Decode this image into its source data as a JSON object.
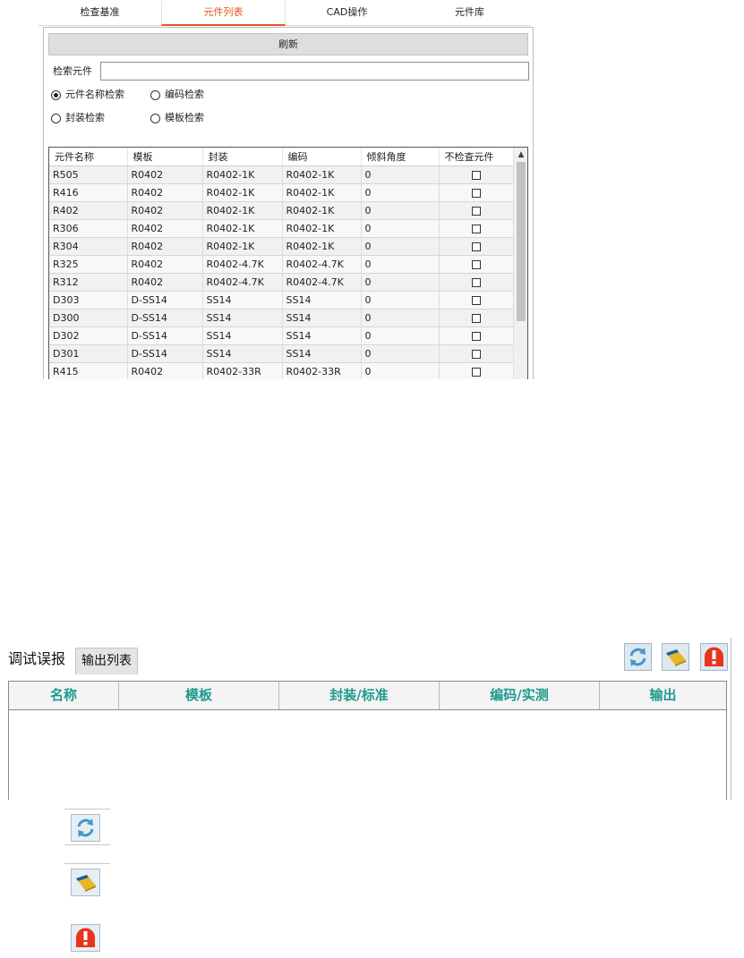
{
  "top_tabs": [
    {
      "label": "检查基准",
      "active": false
    },
    {
      "label": "元件列表",
      "active": true
    },
    {
      "label": "CAD操作",
      "active": false
    },
    {
      "label": "元件库",
      "active": false
    }
  ],
  "refresh_label": "刷新",
  "search": {
    "label": "检索元件",
    "value": ""
  },
  "radios": [
    {
      "label": "元件名称检索",
      "checked": true
    },
    {
      "label": "编码检索",
      "checked": false
    },
    {
      "label": "封装检索",
      "checked": false
    },
    {
      "label": "模板检索",
      "checked": false
    }
  ],
  "grid": {
    "columns": [
      "元件名称",
      "模板",
      "封装",
      "编码",
      "倾斜角度",
      "不检查元件"
    ],
    "rows": [
      [
        "R505",
        "R0402",
        "R0402-1K",
        "R0402-1K",
        "0"
      ],
      [
        "R416",
        "R0402",
        "R0402-1K",
        "R0402-1K",
        "0"
      ],
      [
        "R402",
        "R0402",
        "R0402-1K",
        "R0402-1K",
        "0"
      ],
      [
        "R306",
        "R0402",
        "R0402-1K",
        "R0402-1K",
        "0"
      ],
      [
        "R304",
        "R0402",
        "R0402-1K",
        "R0402-1K",
        "0"
      ],
      [
        "R325",
        "R0402",
        "R0402-4.7K",
        "R0402-4.7K",
        "0"
      ],
      [
        "R312",
        "R0402",
        "R0402-4.7K",
        "R0402-4.7K",
        "0"
      ],
      [
        "D303",
        "D-SS14",
        "SS14",
        "SS14",
        "0"
      ],
      [
        "D300",
        "D-SS14",
        "SS14",
        "SS14",
        "0"
      ],
      [
        "D302",
        "D-SS14",
        "SS14",
        "SS14",
        "0"
      ],
      [
        "D301",
        "D-SS14",
        "SS14",
        "SS14",
        "0"
      ],
      [
        "R415",
        "R0402",
        "R0402-33R",
        "R0402-33R",
        "0"
      ]
    ]
  },
  "bottom": {
    "tabs": [
      "调试误报",
      "输出列表"
    ],
    "columns": [
      "名称",
      "模板",
      "封装/标准",
      "编码/实测",
      "输出"
    ],
    "tool_icons": [
      "refresh-icon",
      "eraser-icon",
      "alarm-icon"
    ]
  },
  "legend_icons": [
    "refresh-icon",
    "eraser-icon",
    "alarm-icon"
  ],
  "colors": {
    "active_tab": "#e0572a",
    "header_text": "#1e9a8e",
    "alarm_red": "#e8341c",
    "eraser_yellow": "#e8b728",
    "refresh_blue": "#3f97cf"
  }
}
